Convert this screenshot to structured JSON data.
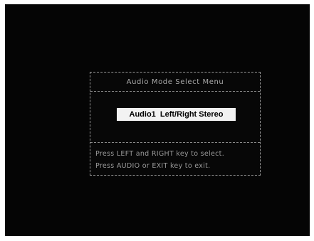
{
  "menu": {
    "title": "Audio Mode Select Menu",
    "selected_mode": "Audio1  Left/Right Stereo",
    "instructions": [
      "Press LEFT and RIGHT key to select.",
      "Press AUDIO or EXIT key to exit."
    ]
  },
  "colors": {
    "screen_background": "#050505",
    "highlight_background": "#f2f2f2",
    "text": "#a9a9a9"
  }
}
